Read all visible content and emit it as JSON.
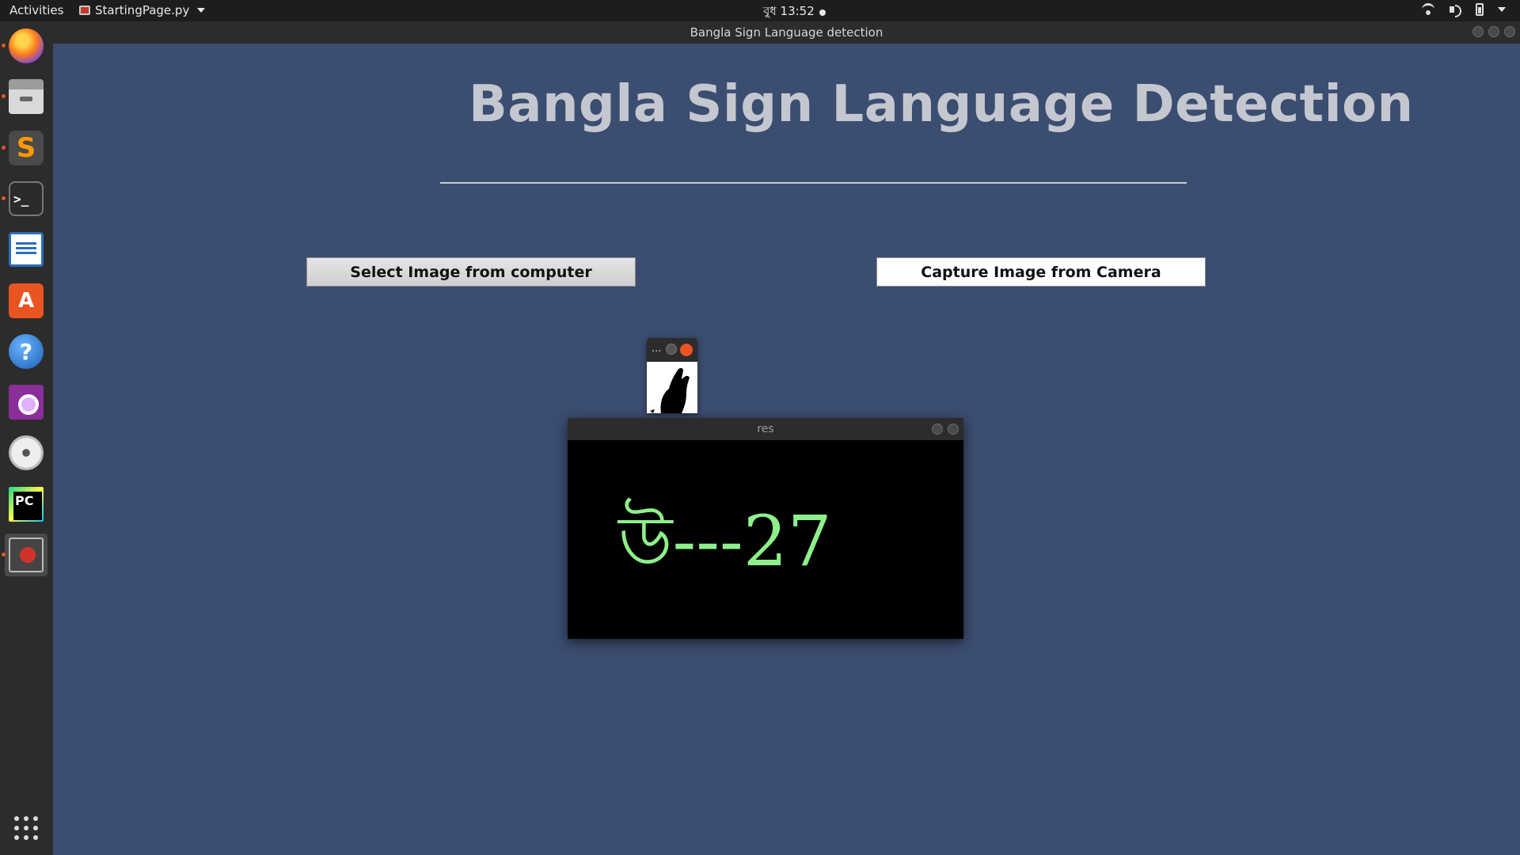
{
  "topbar": {
    "activities": "Activities",
    "app_name": "StartingPage.py",
    "clock": "বুধ 13:52"
  },
  "dock": {
    "items": [
      "firefox-icon",
      "files-icon",
      "sublime-icon",
      "terminal-icon",
      "writer-icon",
      "software-icon",
      "help-icon",
      "video-icon",
      "dvd-icon",
      "pycharm-icon",
      "app-icon"
    ]
  },
  "window": {
    "title": "Bangla Sign Language detection",
    "heading": "Bangla Sign Language Detection",
    "select_button": "Select Image from computer",
    "capture_button": "Capture Image from Camera"
  },
  "mini_window": {
    "title": "..."
  },
  "res_window": {
    "title": "res",
    "result": "উ---27"
  },
  "colors": {
    "background": "#3b4d70",
    "result_text": "#8ef08a",
    "accent": "#e95420"
  }
}
